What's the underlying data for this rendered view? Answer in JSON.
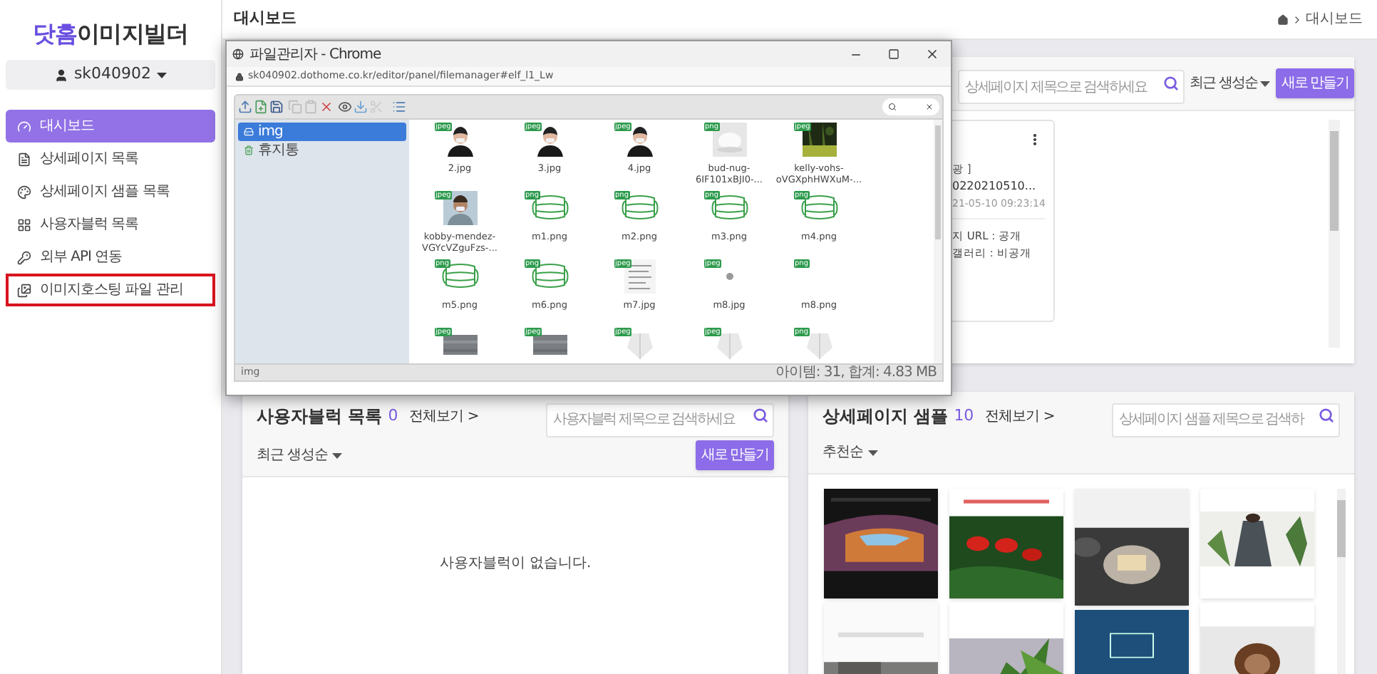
{
  "sidebar": {
    "logo": {
      "brand": "닷홈",
      "product": "이미지빌더"
    },
    "user": "sk040902",
    "items": [
      {
        "label": "대시보드",
        "selected": true,
        "outlined": false
      },
      {
        "label": "상세페이지 목록",
        "selected": false,
        "outlined": false
      },
      {
        "label": "상세페이지 샘플 목록",
        "selected": false,
        "outlined": false
      },
      {
        "label": "사용자블럭 목록",
        "selected": false,
        "outlined": false
      },
      {
        "label": "외부 API 연동",
        "selected": false,
        "outlined": false
      },
      {
        "label": "이미지호스팅 파일 관리",
        "selected": false,
        "outlined": true
      }
    ]
  },
  "header": {
    "title": "대시보드",
    "breadcrumb": "대시보드"
  },
  "top_panel": {
    "search": {
      "placeholder": "상세페이지 제목으로 검색하세요"
    },
    "sort": "최근 생성순",
    "new_button": "새로 만들기",
    "card_fragment": [
      "광 ]",
      "0220210510...",
      "21-05-10 09:23:14",
      "지 URL : 공개",
      "갤러리 : 비공개"
    ]
  },
  "popup": {
    "title": "파일관리자 - Chrome",
    "url": "sk040902.dothome.co.kr/editor/panel/filemanager#elf_l1_Lw",
    "tree": [
      {
        "label": "img",
        "selected": true,
        "kind": "folder"
      },
      {
        "label": "휴지통",
        "selected": false,
        "kind": "trash"
      }
    ],
    "files": [
      {
        "name": "2.jpg",
        "type": "jpeg",
        "kind": "person"
      },
      {
        "name": "3.jpg",
        "type": "jpeg",
        "kind": "person"
      },
      {
        "name": "4.jpg",
        "type": "jpeg",
        "kind": "person"
      },
      {
        "name": "bud-nug-6IF101xBJI0-...",
        "type": "png",
        "kind": "product"
      },
      {
        "name": "kelly-vohs-oVGXphHWXuM-...",
        "type": "jpeg",
        "kind": "plant"
      },
      {
        "name": "kobby-mendez-VGYcVZguFzs-...",
        "type": "jpeg",
        "kind": "man"
      },
      {
        "name": "m1.png",
        "type": "png",
        "kind": "mask"
      },
      {
        "name": "m2.png",
        "type": "png",
        "kind": "mask"
      },
      {
        "name": "m3.png",
        "type": "png",
        "kind": "mask"
      },
      {
        "name": "m4.png",
        "type": "png",
        "kind": "mask"
      },
      {
        "name": "m5.png",
        "type": "png",
        "kind": "mask"
      },
      {
        "name": "m6.png",
        "type": "png",
        "kind": "mask"
      },
      {
        "name": "m7.jpg",
        "type": "jpeg",
        "kind": "document"
      },
      {
        "name": "m8.jpg",
        "type": "jpeg",
        "kind": "dot"
      },
      {
        "name": "m8.png",
        "type": "png",
        "kind": "blank"
      },
      {
        "type": "jpeg",
        "kind": "fabric"
      },
      {
        "type": "jpeg",
        "kind": "fabric"
      },
      {
        "type": "jpeg",
        "kind": "respirator"
      },
      {
        "type": "jpeg",
        "kind": "respirator"
      },
      {
        "type": "png",
        "kind": "respirator"
      }
    ],
    "status_path": "img",
    "status_info": "아이템: 31, 합계: 4.83 MB"
  },
  "user_blocks": {
    "title": "사용자블럭 목록",
    "count": "0",
    "view_all": "전체보기 >",
    "search": {
      "placeholder": "사용자블럭 제목으로 검색하세요"
    },
    "sort": "최근 생성순",
    "new_button": "새로 만들기",
    "empty_text": "사용자블럭이 없습니다."
  },
  "samples": {
    "title": "상세페이지 샘플",
    "count": "10",
    "view_all": "전체보기 >",
    "search": {
      "placeholder": "상세페이지 샘플 제목으로 검색하"
    },
    "sort": "추천순"
  }
}
